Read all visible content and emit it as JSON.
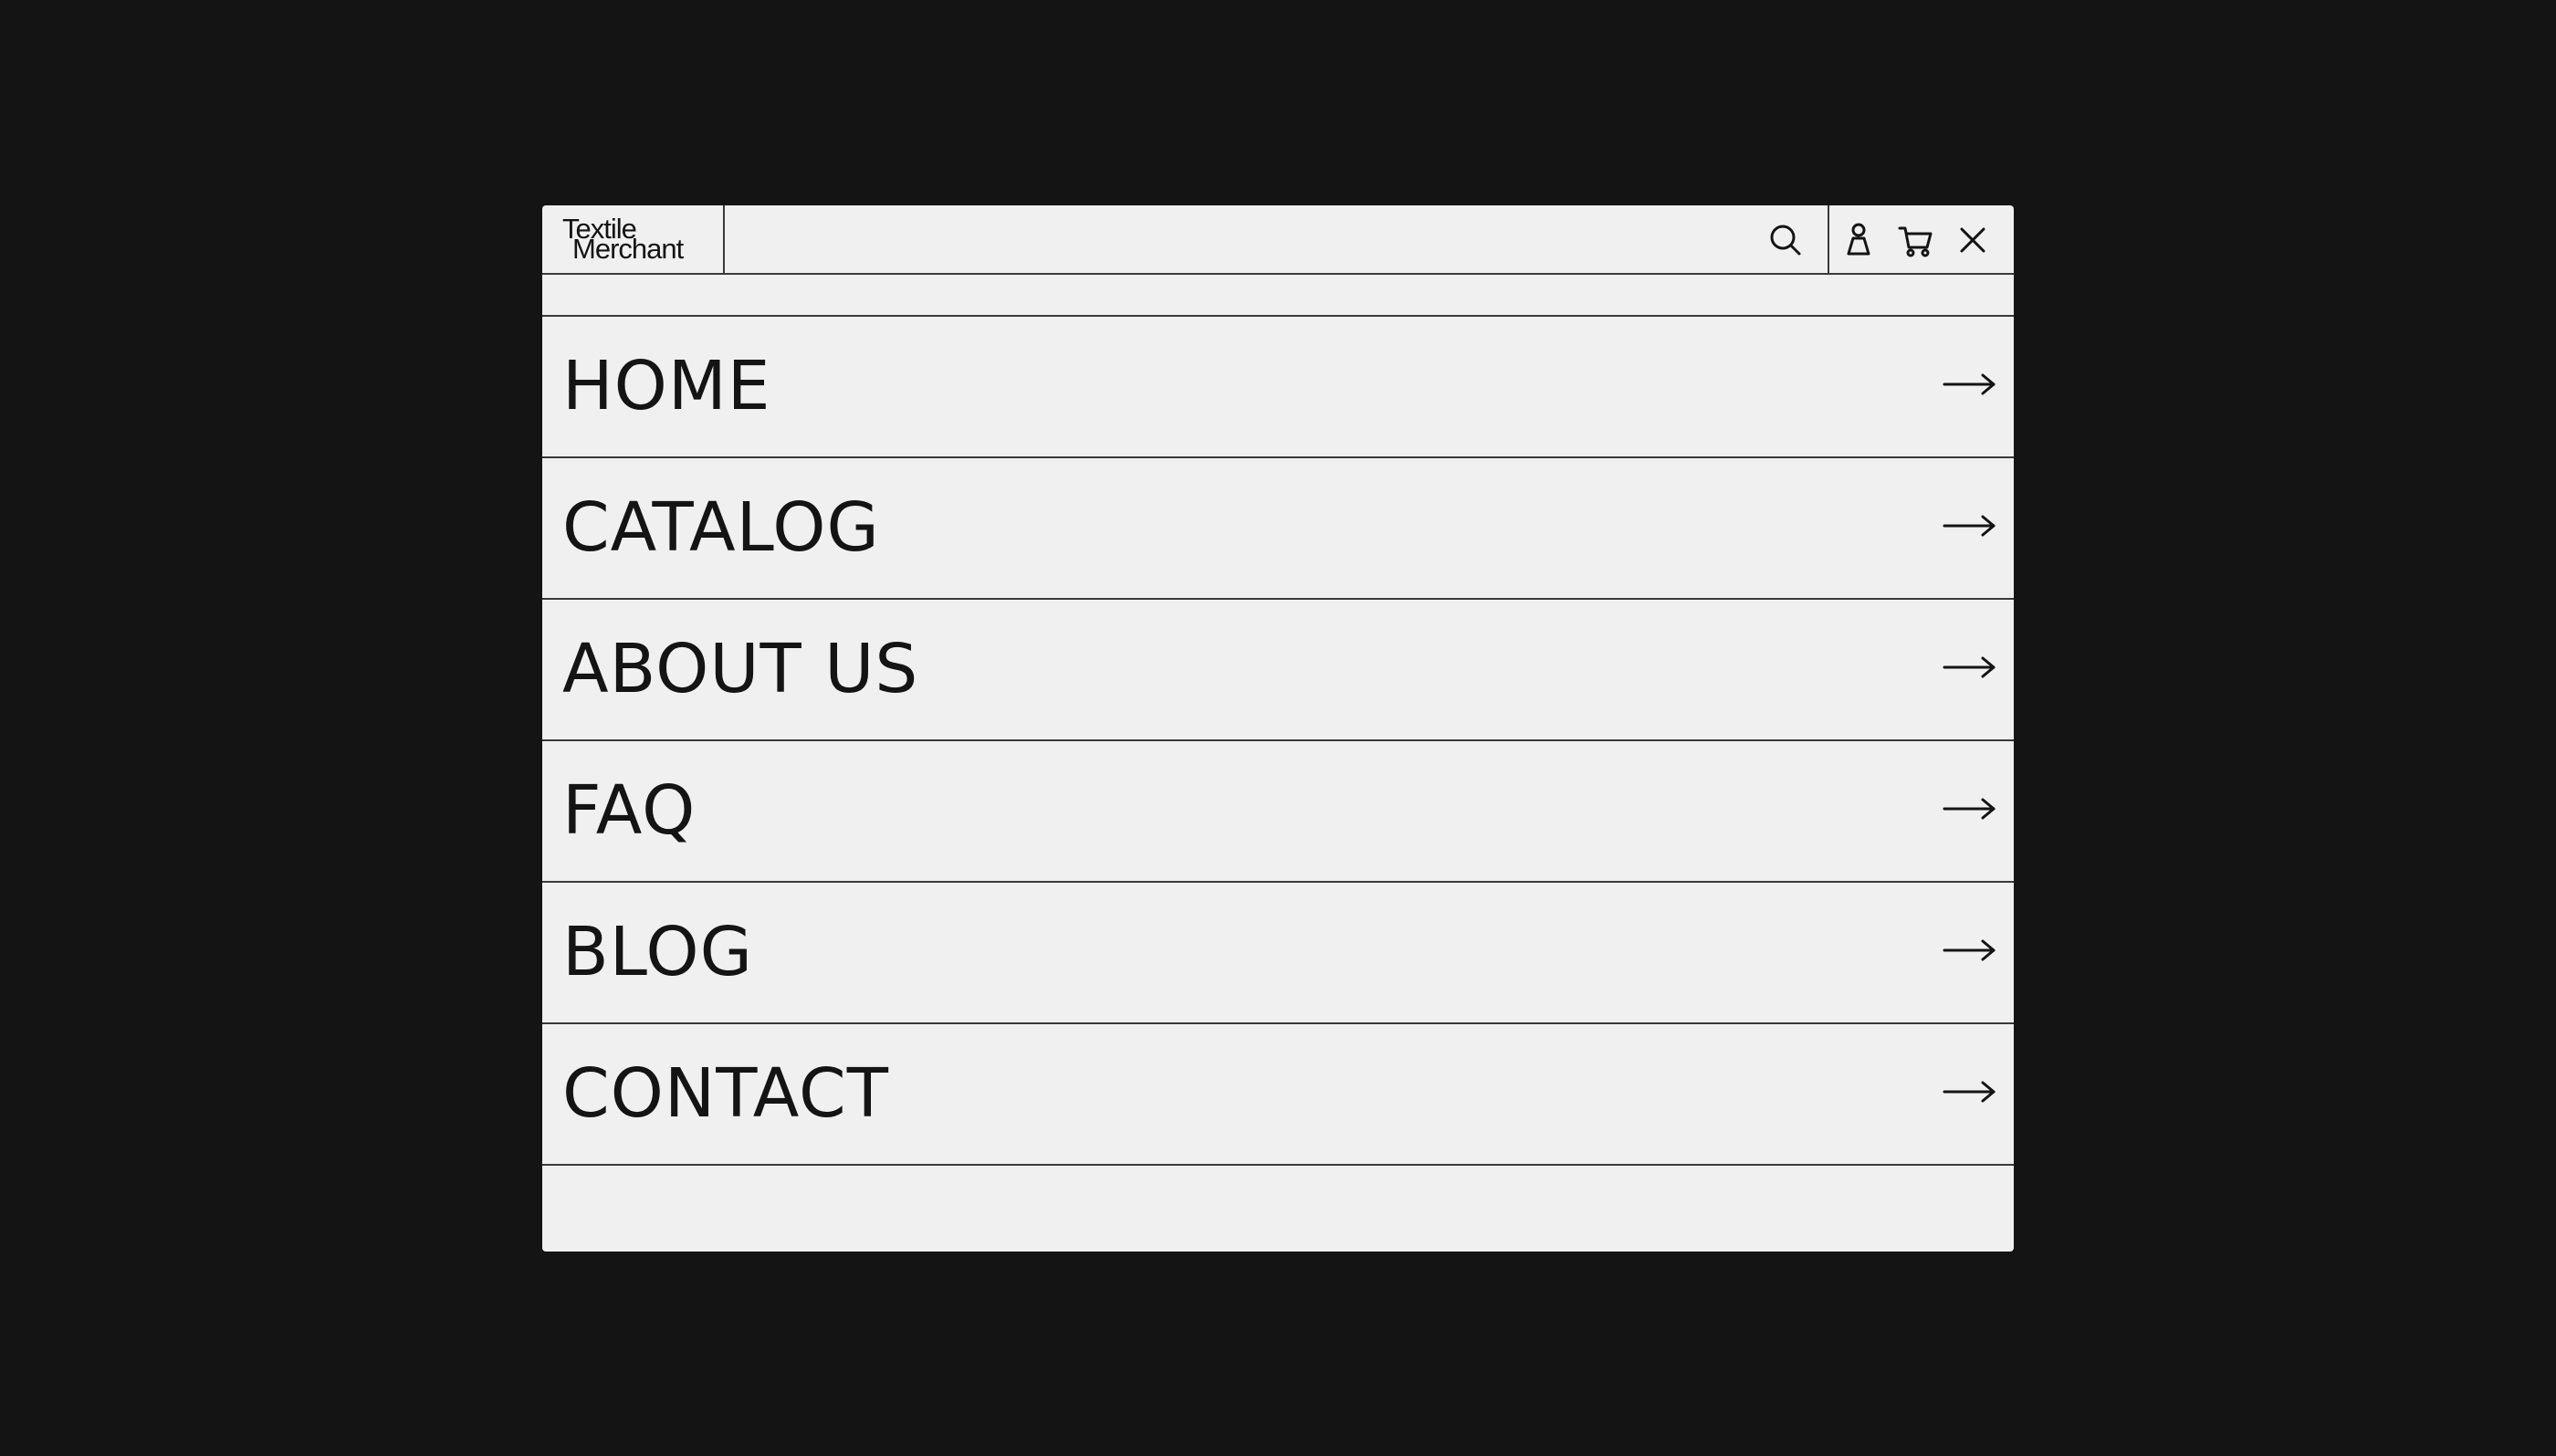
{
  "brand": {
    "line1": "Textile",
    "line2": "Merchant"
  },
  "header": {
    "icons": [
      "search-icon",
      "user-icon",
      "cart-icon",
      "close-icon"
    ]
  },
  "menu": {
    "items": [
      {
        "label": "HOME",
        "icon": "arrow-right-icon"
      },
      {
        "label": "CATALOG",
        "icon": "arrow-right-icon"
      },
      {
        "label": "ABOUT US",
        "icon": "arrow-right-icon"
      },
      {
        "label": "FAQ",
        "icon": "arrow-right-icon"
      },
      {
        "label": "BLOG",
        "icon": "arrow-right-icon"
      },
      {
        "label": "CONTACT",
        "icon": "arrow-right-icon"
      }
    ]
  },
  "colors": {
    "background": "#141414",
    "panel": "#f0f0f0",
    "text": "#141414",
    "border": "#3a3a3a"
  }
}
